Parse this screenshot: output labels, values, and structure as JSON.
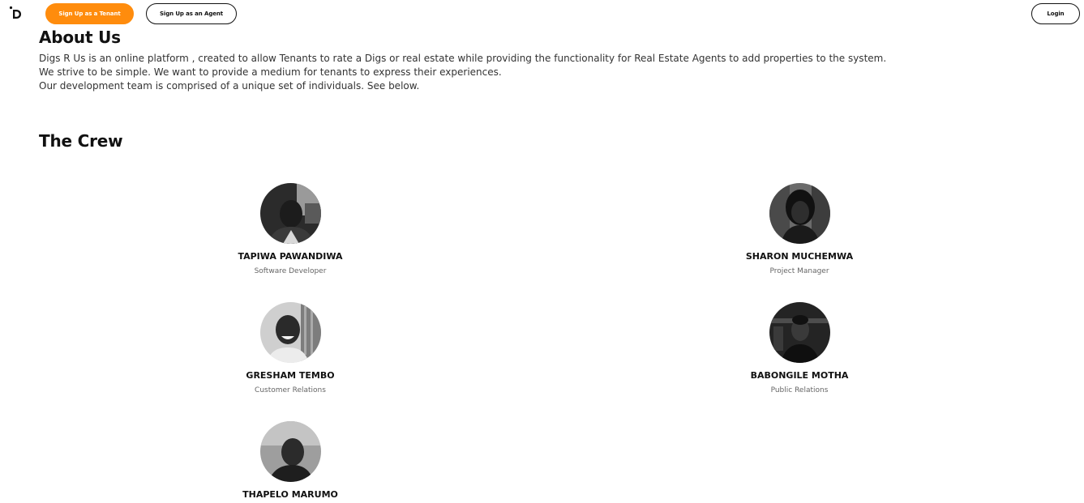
{
  "header": {
    "logo_icon": "digs-logo-icon",
    "tenant_button": "Sign Up as a Tenant",
    "agent_button": "Sign Up as an Agent",
    "login_button": "Login",
    "accent_color": "#ff8c0d"
  },
  "about": {
    "title": "About Us",
    "paragraphs": [
      "Digs R Us is an online platform , created to allow Tenants to rate a Digs or real estate while providing the functionality for Real Estate Agents to add properties to the system.",
      "We strive to be simple. We want to provide a medium for tenants to express their experiences.",
      "Our development team is comprised of a unique set of individuals. See below."
    ]
  },
  "crew": {
    "title": "The Crew",
    "members": [
      {
        "name": "TAPIWA PAWANDIWA",
        "role": "Software Developer"
      },
      {
        "name": "SHARON MUCHEMWA",
        "role": "Project Manager"
      },
      {
        "name": "GRESHAM TEMBO",
        "role": "Customer Relations"
      },
      {
        "name": "BABONGILE MOTHA",
        "role": "Public Relations"
      },
      {
        "name": "THAPELO MARUMO",
        "role": ""
      }
    ]
  }
}
